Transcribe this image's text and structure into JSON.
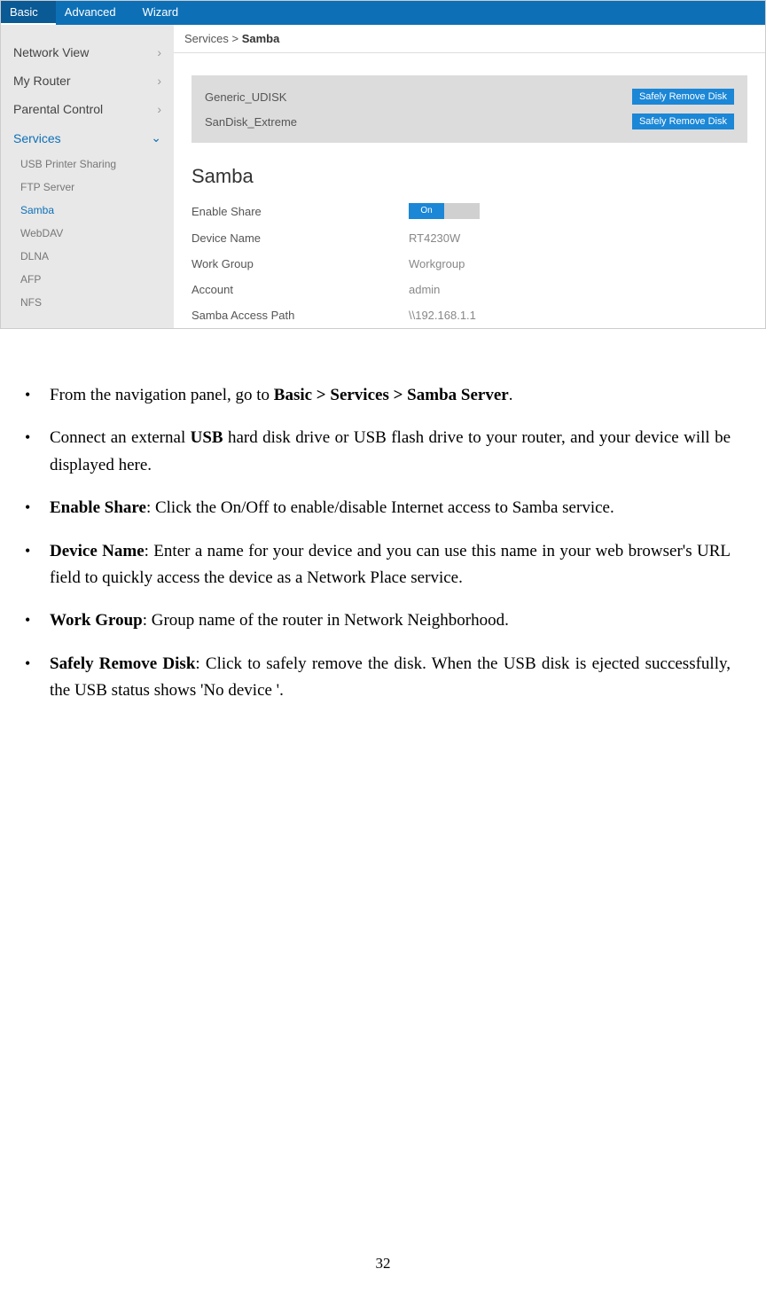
{
  "tabs": [
    "Basic",
    "Advanced",
    "Wizard"
  ],
  "active_tab": 0,
  "sidebar": {
    "items": [
      {
        "label": "Network View",
        "chev": "›"
      },
      {
        "label": "My Router",
        "chev": "›"
      },
      {
        "label": "Parental Control",
        "chev": "›"
      },
      {
        "label": "Services",
        "chev": "⌄",
        "active": true
      }
    ],
    "sub_items": [
      {
        "label": "USB Printer Sharing"
      },
      {
        "label": "FTP Server"
      },
      {
        "label": "Samba",
        "active": true
      },
      {
        "label": "WebDAV"
      },
      {
        "label": "DLNA"
      },
      {
        "label": "AFP"
      },
      {
        "label": "NFS"
      }
    ]
  },
  "breadcrumb": {
    "path": "Services >",
    "current": "Samba"
  },
  "devices": [
    {
      "name": "Generic_UDISK",
      "button": "Safely Remove Disk"
    },
    {
      "name": "SanDisk_Extreme",
      "button": "Safely Remove Disk"
    }
  ],
  "section_title": "Samba",
  "form": {
    "enable_share": {
      "label": "Enable Share",
      "toggle_on": "On"
    },
    "device_name": {
      "label": "Device Name",
      "value": "RT4230W"
    },
    "work_group": {
      "label": "Work Group",
      "value": "Workgroup"
    },
    "account": {
      "label": "Account",
      "value": "admin"
    },
    "samba_path": {
      "label": "Samba Access Path",
      "value": "\\\\192.168.1.1"
    }
  },
  "bullets": [
    {
      "pre": "From the navigation panel, go to ",
      "bold": "Basic > Services > Samba Server",
      "post": "."
    },
    {
      "pre": "Connect an external ",
      "bold": "USB",
      "post": " hard disk drive or USB flash drive to your router, and your device will be displayed here."
    },
    {
      "bold": "Enable Share",
      "post": ": Click the On/Off to enable/disable Internet access to Samba service."
    },
    {
      "bold": "Device Name",
      "post": ": Enter a name for your device and you can use this name in your web browser's URL field to quickly access the device as a Network Place service."
    },
    {
      "bold": "Work Group",
      "post": ": Group name of the router in Network Neighborhood."
    },
    {
      "bold": "Safely Remove Disk",
      "post": ": Click to safely remove the disk. When the USB disk is ejected successfully, the USB status shows 'No device '."
    }
  ],
  "page_number": "32"
}
